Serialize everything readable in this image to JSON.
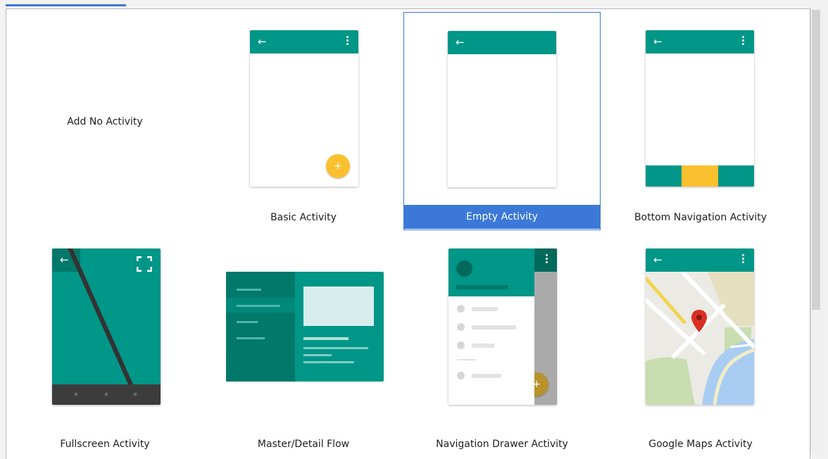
{
  "tab_indicator_color": "#3b78d8",
  "colors": {
    "primary": "#009688",
    "dark": "#00796b",
    "accent": "#fbc02d",
    "selection": "#3b78d8"
  },
  "templates": [
    {
      "label": "Add No Activity"
    },
    {
      "label": "Basic Activity",
      "icons": [
        "back-arrow-icon",
        "overflow-menu-icon",
        "add-icon"
      ]
    },
    {
      "label": "Empty Activity",
      "selected": true,
      "icons": [
        "back-arrow-icon"
      ]
    },
    {
      "label": "Bottom Navigation Activity",
      "icons": [
        "back-arrow-icon",
        "overflow-menu-icon"
      ]
    },
    {
      "label": "Fullscreen Activity",
      "icons": [
        "back-arrow-icon",
        "fullscreen-icon"
      ]
    },
    {
      "label": "Master/Detail Flow"
    },
    {
      "label": "Navigation Drawer Activity",
      "icons": [
        "overflow-menu-icon",
        "add-icon"
      ]
    },
    {
      "label": "Google Maps Activity",
      "icons": [
        "back-arrow-icon",
        "overflow-menu-icon",
        "map-pin-icon"
      ]
    }
  ],
  "glyphs": {
    "back_arrow": "←",
    "fab_plus": "+"
  }
}
